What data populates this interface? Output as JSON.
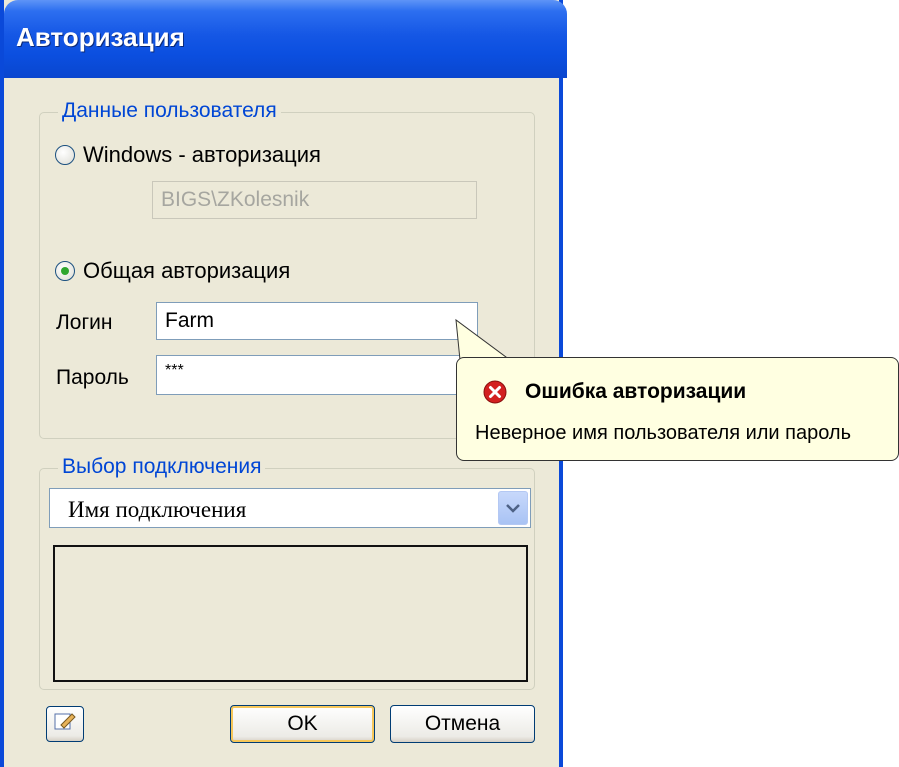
{
  "window": {
    "title": "Авторизация"
  },
  "user_data": {
    "legend": "Данные пользователя",
    "windows_auth": {
      "label": "Windows - авторизация",
      "selected": false,
      "value": "BIGS\\ZKolesnik"
    },
    "common_auth": {
      "label": "Общая авторизация",
      "selected": true
    },
    "login": {
      "label": "Логин",
      "value": "Farm"
    },
    "password": {
      "label": "Пароль",
      "value": "***"
    }
  },
  "connection": {
    "legend": "Выбор подключения",
    "selected": "Имя подключения"
  },
  "buttons": {
    "ok": "OK",
    "cancel": "Отмена"
  },
  "tooltip": {
    "title": "Ошибка авторизации",
    "message": "Неверное имя пользователя или пароль"
  },
  "icons": {
    "edit": "edit-icon",
    "error": "error-icon",
    "dropdown": "chevron-down-icon"
  },
  "colors": {
    "titlebar": "#0a4fe0",
    "legend": "#0046d5",
    "tooltip_bg": "#ffffe1",
    "error": "#d32020"
  }
}
